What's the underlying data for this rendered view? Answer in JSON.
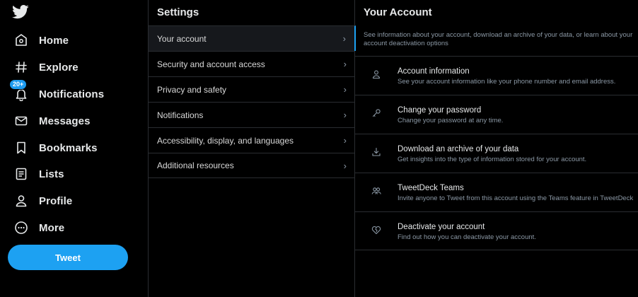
{
  "nav": {
    "items": [
      {
        "label": "Home",
        "icon": "home-icon"
      },
      {
        "label": "Explore",
        "icon": "hashtag-icon"
      },
      {
        "label": "Notifications",
        "icon": "bell-icon",
        "badge": "20+"
      },
      {
        "label": "Messages",
        "icon": "envelope-icon"
      },
      {
        "label": "Bookmarks",
        "icon": "bookmark-icon"
      },
      {
        "label": "Lists",
        "icon": "list-icon"
      },
      {
        "label": "Profile",
        "icon": "person-icon"
      },
      {
        "label": "More",
        "icon": "more-icon"
      }
    ],
    "tweet_label": "Tweet"
  },
  "settings": {
    "title": "Settings",
    "items": [
      {
        "label": "Your account"
      },
      {
        "label": "Security and account access"
      },
      {
        "label": "Privacy and safety"
      },
      {
        "label": "Notifications"
      },
      {
        "label": "Accessibility, display, and languages"
      },
      {
        "label": "Additional resources"
      }
    ],
    "active_index": 0
  },
  "account": {
    "title": "Your Account",
    "intro": "See information about your account, download an archive of your data, or learn about your account deactivation options",
    "items": [
      {
        "title": "Account information",
        "desc": "See your account information like your phone number and email address.",
        "icon": "person-icon"
      },
      {
        "title": "Change your password",
        "desc": "Change your password at any time.",
        "icon": "key-icon"
      },
      {
        "title": "Download an archive of your data",
        "desc": "Get insights into the type of information stored for your account.",
        "icon": "download-icon"
      },
      {
        "title": "TweetDeck Teams",
        "desc": "Invite anyone to Tweet from this account using the Teams feature in TweetDeck",
        "icon": "people-icon"
      },
      {
        "title": "Deactivate your account",
        "desc": "Find out how you can deactivate your account.",
        "icon": "broken-heart-icon"
      }
    ]
  },
  "colors": {
    "background": "#000000",
    "accent": "#1da1f2",
    "border": "#2a2d31",
    "muted_text": "#8b98a5"
  }
}
